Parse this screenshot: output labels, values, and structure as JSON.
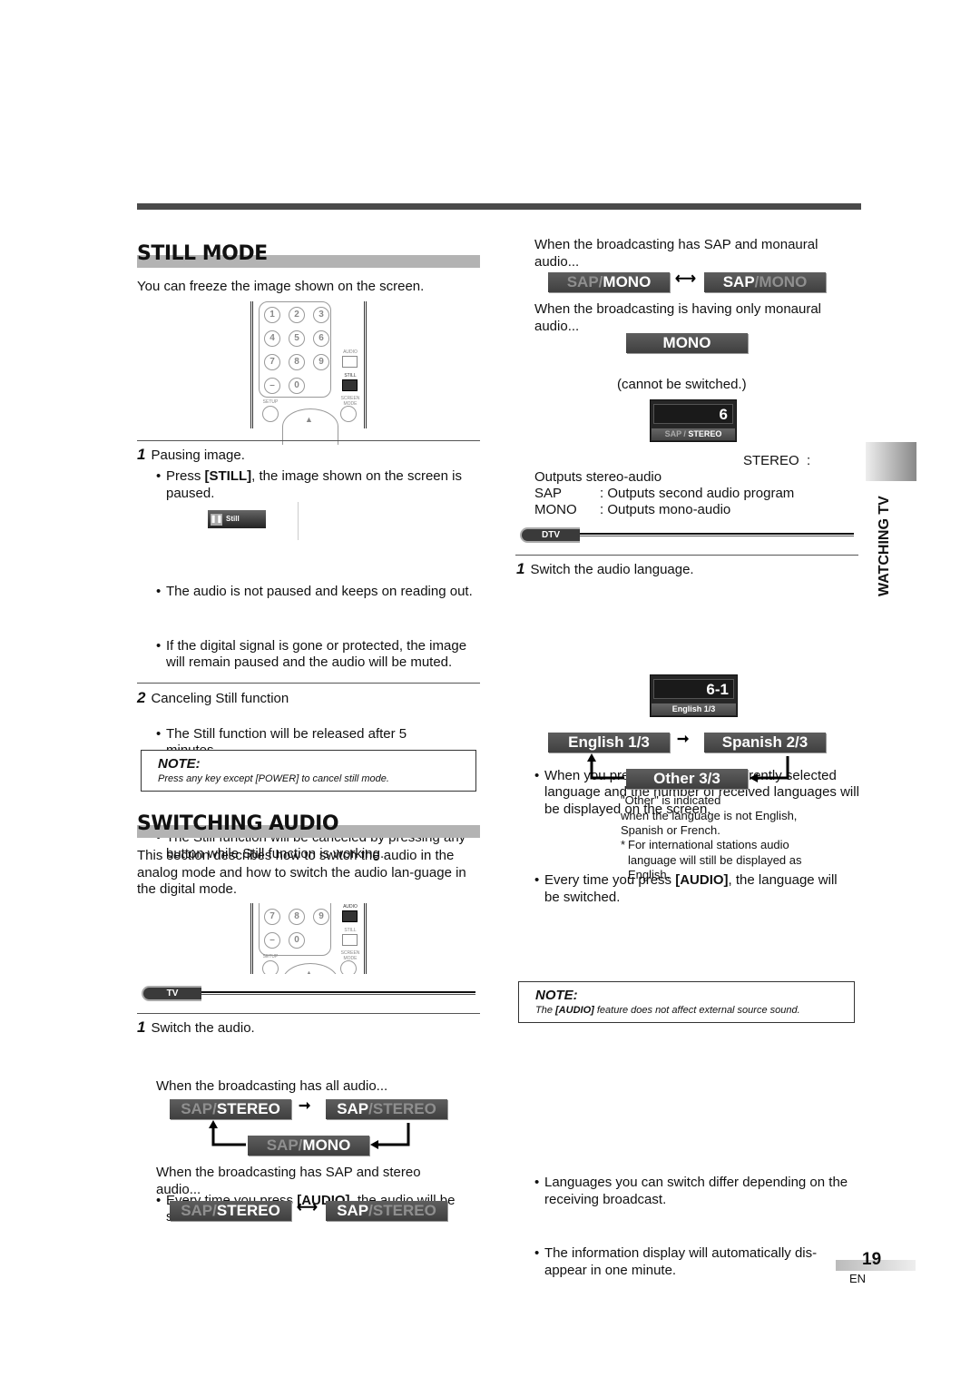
{
  "page": {
    "number": "19",
    "lang": "EN",
    "side_tab": "WATCHING TV"
  },
  "still_mode": {
    "title": "STILL MODE",
    "intro": "You can freeze the image shown on the screen.",
    "remote": {
      "keys": [
        "1",
        "2",
        "3",
        "4",
        "5",
        "6",
        "7",
        "8",
        "9",
        "–",
        "0"
      ],
      "labels": {
        "audio": "AUDIO",
        "still": "STILL",
        "setup": "SETUP",
        "screen_mode": "SCREEN MODE"
      },
      "highlighted": "STILL"
    },
    "step1": {
      "num": "1",
      "title": "Pausing image.",
      "bullet1_pre": "Press ",
      "bullet1_bold": "[STILL]",
      "bullet1_post": ", the image shown on the screen is paused.",
      "osd_label": "Still",
      "bullets": [
        "The audio is not paused and keeps on reading out.",
        "If the digital signal is gone or protected, the image will remain paused and the audio will be muted.",
        "The Still function will be released after 5 minutes."
      ]
    },
    "step2": {
      "num": "2",
      "title": "Canceling Still function",
      "bullets": [
        "The Still function will be canceled by pressing any button while Still function is working."
      ]
    },
    "note": {
      "title": "NOTE:",
      "text": "Press any key except [POWER] to cancel still mode."
    }
  },
  "switching_audio": {
    "title": "SWITCHING AUDIO",
    "intro": "This section describes how to switch the audio in the analog mode and how to switch the audio lan-guage in the digital mode.",
    "remote": {
      "highlighted": "AUDIO"
    },
    "tv_pill": "TV",
    "step1": {
      "num": "1",
      "title": "Switch the audio.",
      "bullet_pre": "Every time you press ",
      "bullet_bold": "[AUDIO]",
      "bullet_post": ", the audio will be switched as below.",
      "all_audio": "When the broadcasting has all audio...",
      "sap_stereo": "When the broadcasting has SAP and stereo audio...",
      "sap_mono": "When the broadcasting has SAP and monaural audio...",
      "only_mono": "When the broadcasting is having only monaural audio...",
      "cannot": "(cannot be switched.)"
    },
    "osd": {
      "sap": "SAP",
      "slash": " / ",
      "stereo": "STEREO",
      "mono": "MONO"
    },
    "screen1": {
      "channel": "6",
      "label_dim": "SAP / ",
      "label_bold": "STEREO"
    },
    "definitions": [
      {
        "key": "STEREO",
        "sep": ":",
        "value": "Outputs stereo-audio"
      },
      {
        "key": "SAP",
        "sep": ":",
        "value": "Outputs second audio program"
      },
      {
        "key": "MONO",
        "sep": ":",
        "value": "Outputs mono-audio"
      }
    ],
    "dtv_pill": "DTV",
    "dtv_step1": {
      "num": "1",
      "title": "Switch the audio language.",
      "b1_pre": "When you press ",
      "b1_bold": "[AUDIO]",
      "b1_post": ", the currently selected language and the number of received languages will be displayed on the screen.",
      "b2_pre": "Every time you press ",
      "b2_bold": "[AUDIO]",
      "b2_post": ", the language will be switched."
    },
    "screen2": {
      "channel": "6-1",
      "label": "English 1/3"
    },
    "languages": [
      "English  1/3",
      "Spanish  2/3",
      "Other  3/3"
    ],
    "other_note": [
      "\"Other\" is indicated",
      "when the language is not English,",
      "Spanish or French."
    ],
    "footnote": "For international stations audio language will still be displayed as English.",
    "bullets": [
      "Languages you can switch differ depending on the receiving broadcast.",
      "The information display will automatically dis-appear in one minute."
    ],
    "note": {
      "title": "NOTE:",
      "text_pre": "The ",
      "text_bold": "[AUDIO]",
      "text_post": " feature does not affect external source sound."
    }
  }
}
